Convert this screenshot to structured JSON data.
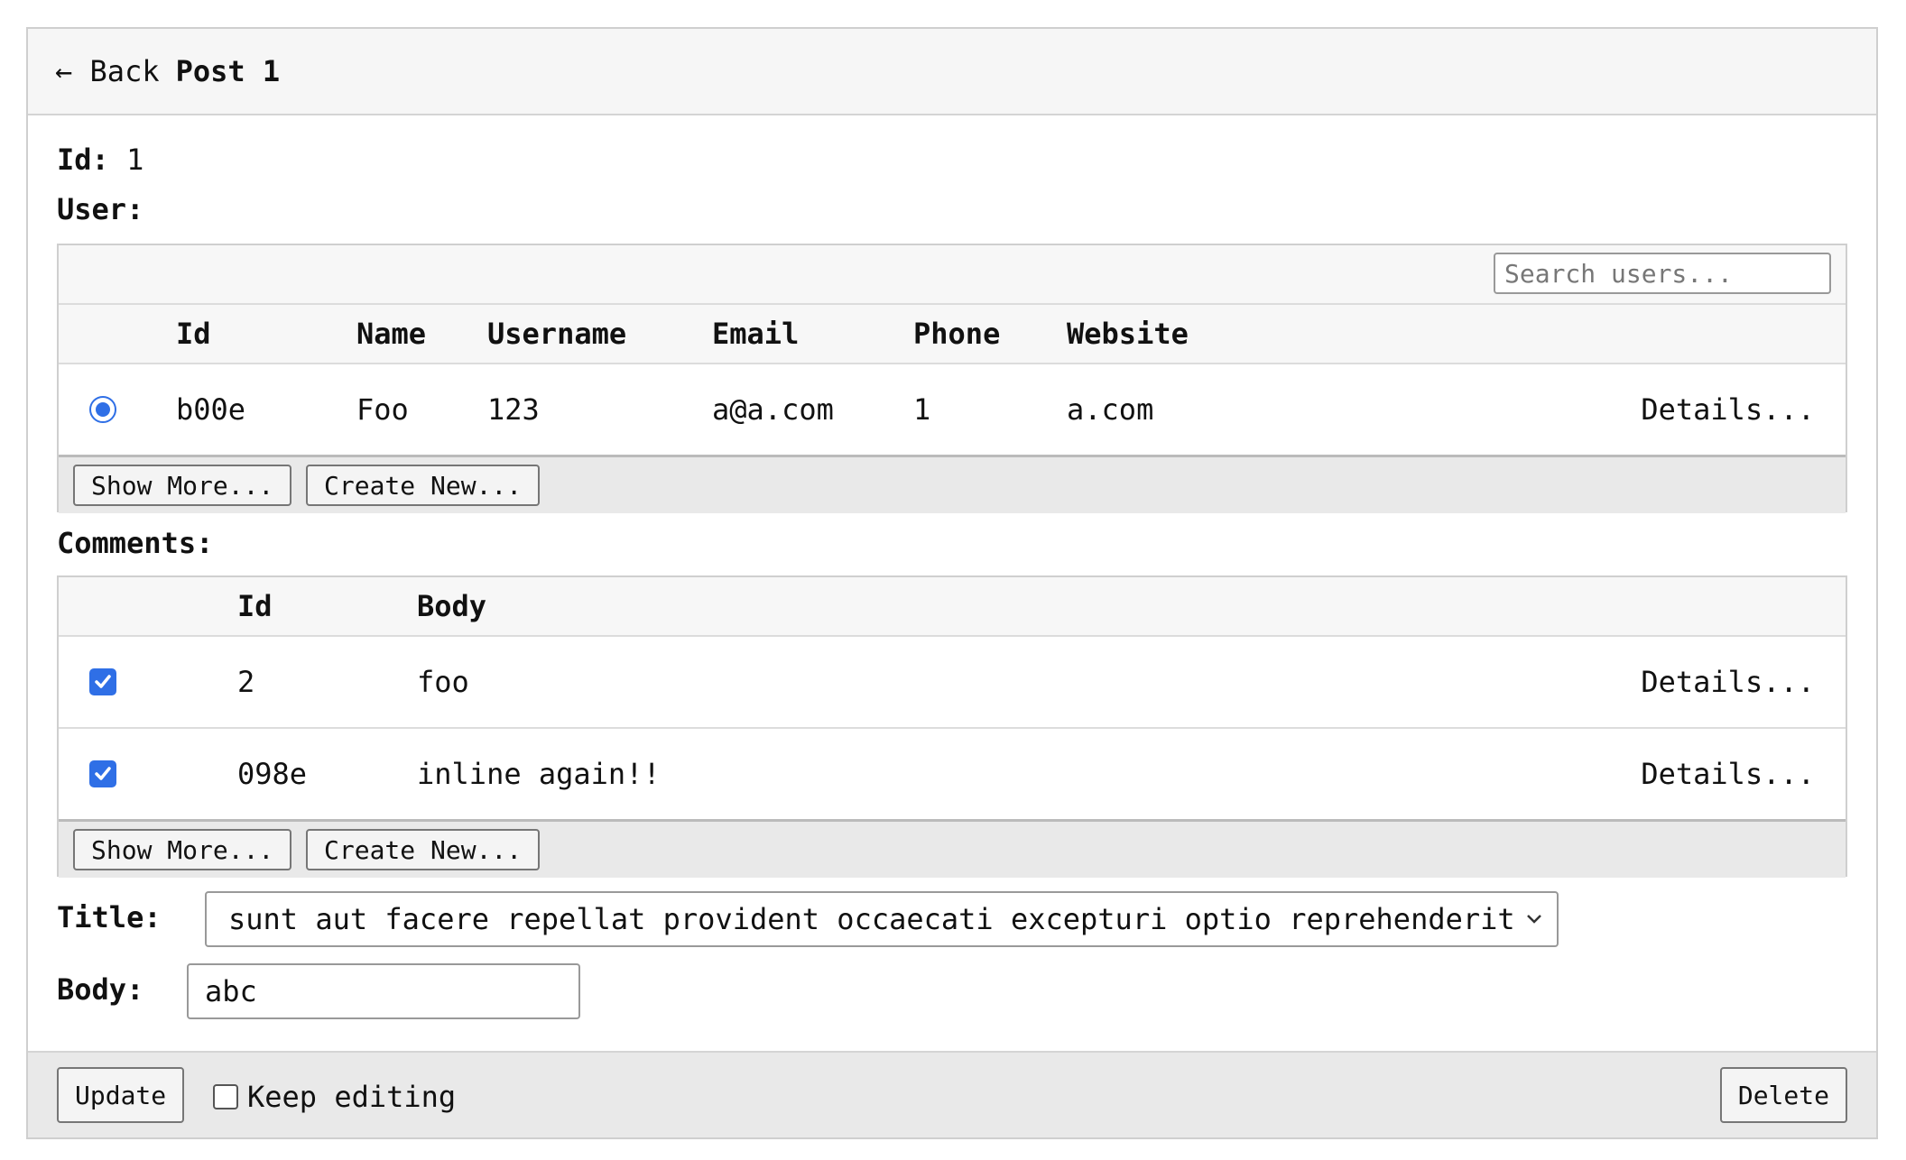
{
  "header": {
    "back_label": "← Back",
    "title": "Post 1"
  },
  "fields": {
    "id_label": "Id:",
    "id_value": "1",
    "user_label": "User:",
    "comments_label": "Comments:",
    "title_label": "Title:",
    "body_label": "Body:"
  },
  "users": {
    "search_placeholder": "Search users...",
    "columns": [
      "Id",
      "Name",
      "Username",
      "Email",
      "Phone",
      "Website"
    ],
    "rows": [
      {
        "id": "b00e",
        "name": "Foo",
        "username": "123",
        "email": "a@a.com",
        "phone": "1",
        "website": "a.com",
        "selected": true,
        "details": "Details..."
      }
    ],
    "show_more": "Show More...",
    "create_new": "Create New..."
  },
  "comments": {
    "columns": [
      "Id",
      "Body"
    ],
    "rows": [
      {
        "id": "2",
        "body": "foo",
        "checked": true,
        "details": "Details..."
      },
      {
        "id": "098e",
        "body": "inline again!!",
        "checked": true,
        "details": "Details..."
      }
    ],
    "show_more": "Show More...",
    "create_new": "Create New..."
  },
  "form": {
    "title_value": "sunt aut facere repellat provident occaecati excepturi optio reprehenderit",
    "body_value": "abc"
  },
  "actions": {
    "update": "Update",
    "keep_editing": "Keep editing",
    "keep_editing_checked": false,
    "delete": "Delete"
  },
  "colors": {
    "accent": "#2f6fe6"
  }
}
